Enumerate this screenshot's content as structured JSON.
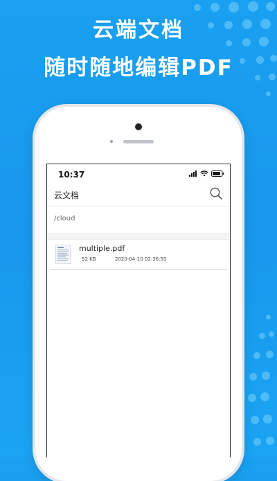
{
  "promo": {
    "line1": "云端文档",
    "line2": "随时随地编辑PDF",
    "background_color": "#1a9ff0"
  },
  "status_bar": {
    "time": "10:37",
    "icons": [
      "signal-icon",
      "wifi-icon",
      "battery-icon"
    ]
  },
  "nav": {
    "title": "云文档",
    "search_icon": "search-icon"
  },
  "path": "/cloud",
  "files": [
    {
      "name": "multiple.pdf",
      "size": "52 KB",
      "modified": "2020-04-10 02:36:55",
      "icon": "pdf-thumbnail-icon"
    }
  ]
}
